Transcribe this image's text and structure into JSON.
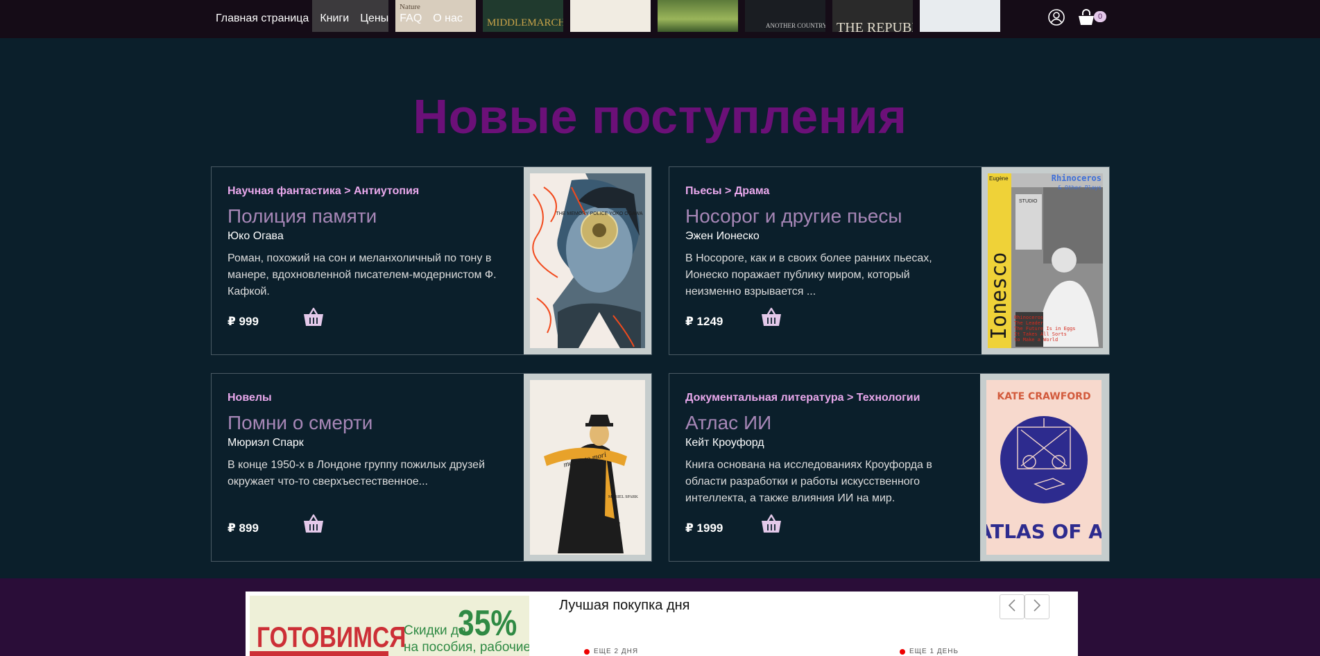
{
  "nav": {
    "links": [
      "Главная страница",
      "Книги",
      "Цены",
      "FAQ",
      "О нас"
    ],
    "strip_titles": [
      "Nature",
      "MIDDLEMARCH",
      "ANOTHER COUNTRY",
      "THE REPUBLIC"
    ],
    "cart_count": "0"
  },
  "section": {
    "title": "Новые поступления"
  },
  "books": [
    {
      "category": "Научная фантастика > Антиутопия",
      "title": "Полиция памяти",
      "author": "Юко Огава",
      "description": "Роман, похожий на сон и меланхоличный по тону в манере, вдохновленной писателем-модернистом Ф. Кафкой.",
      "price": "₽ 999"
    },
    {
      "category": "Пьесы > Драма",
      "title": "Носорог и другие пьесы",
      "author": "Эжен Ионеско",
      "description": "В Носороге, как и в своих более ранних пьесах, Ионеско поражает публику миром, который неизменно взрывается ...",
      "price": "₽ 1249"
    },
    {
      "category": "Новелы",
      "title": "Помни о смерти",
      "author": "Мюриэл Спарк",
      "description": "В конце 1950-х в Лондоне группу пожилых друзей окружает что-то сверхъестественное...",
      "price": "₽ 899"
    },
    {
      "category": "Документальная литература > Технологии",
      "title": "Атлас ИИ",
      "author": "Кейт Кроуфорд",
      "description": "Книга основана на исследованиях Кроуфорда в области разработки и работы искусственного интеллекта, а также влияния ИИ на мир.",
      "price": "₽ 1999"
    }
  ],
  "covers": {
    "memory_police": {
      "text": "THE MEMORY POLICE YOKO OGAWA"
    },
    "rhinoceros": {
      "author_first": "Eugène",
      "author_vertical": "Ionesco",
      "title": "Rhinoceros",
      "subtitle": "& Other Plays",
      "studio": "STUDIO",
      "list": [
        "Rhinoceros",
        "The Leader",
        "The Future Is in Eggs",
        "It Takes All Sorts",
        "to Make a World"
      ]
    },
    "memento_mori": {
      "title": "memento mori",
      "author": "MURIEL SPARK"
    },
    "atlas_ai": {
      "author": "KATE CRAWFORD",
      "title": "ATLAS OF AI"
    }
  },
  "promo": {
    "banner_title": "ГОТОВИМСЯ",
    "banner_discount": "Скидки до",
    "banner_percent": "35%",
    "banner_sub": "на пособия, рабочие",
    "deal_title": "Лучшая покупка дня",
    "timer_left": "ЕЩЕ 2 ДНЯ",
    "timer_right": "ЕЩЕ 1 ДЕНЬ"
  },
  "colors": {
    "page_bg": "#0b1f2b",
    "nav_bg": "#150c17",
    "section_title": "#6b1078",
    "category": "#e9a8ec",
    "book_title": "#a787b7",
    "basket": "#e4c9ea",
    "bottom_band": "#2a0d38"
  }
}
